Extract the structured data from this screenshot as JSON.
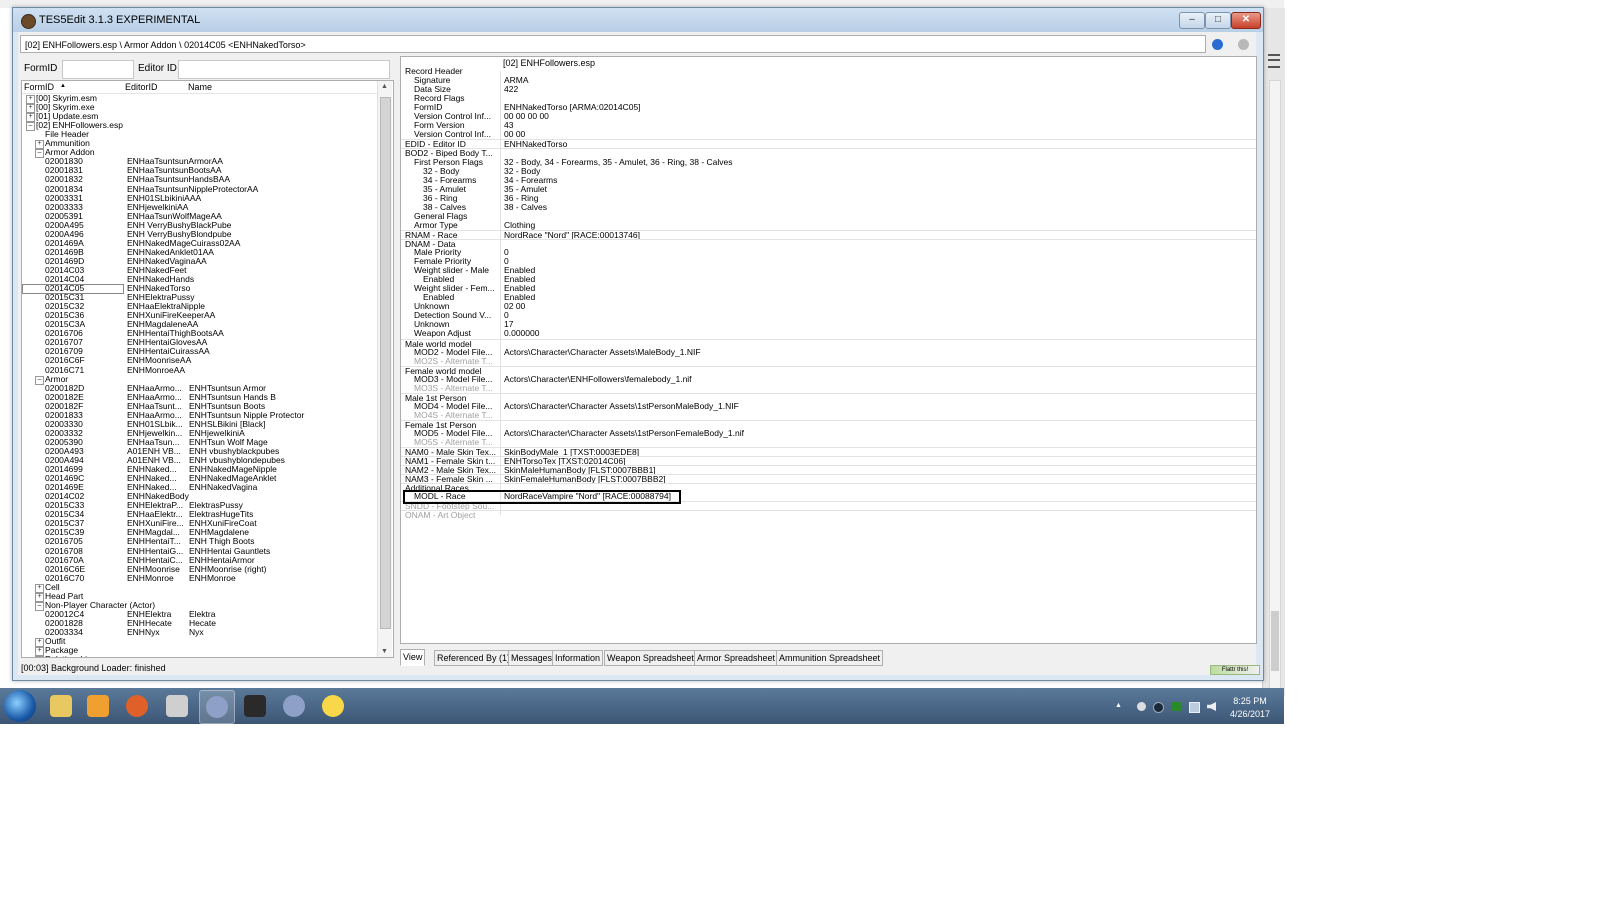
{
  "window": {
    "title": "TES5Edit 3.1.3 EXPERIMENTAL",
    "path": "[02] ENHFollowers.esp \\ Armor Addon \\ 02014C05 <ENHNakedTorso>",
    "controls": {
      "minimize": "–",
      "maximize": "□",
      "close": "✕"
    }
  },
  "filters": {
    "formid_label": "FormID",
    "editorid_label": "Editor ID"
  },
  "tree": {
    "headers": {
      "formid": "FormID",
      "sort_arrow": "▲",
      "editorid": "EditorID",
      "name": "Name"
    },
    "rows": [
      {
        "indent": 0,
        "toggle": "+",
        "id": "[00] Skyrim.esm",
        "edid": "",
        "name": ""
      },
      {
        "indent": 0,
        "toggle": "+",
        "id": "[00] Skyrim.exe",
        "edid": "",
        "name": ""
      },
      {
        "indent": 0,
        "toggle": "+",
        "id": "[01] Update.esm",
        "edid": "",
        "name": ""
      },
      {
        "indent": 0,
        "toggle": "–",
        "id": "[02] ENHFollowers.esp",
        "edid": "",
        "name": ""
      },
      {
        "indent": 1,
        "toggle": "",
        "id": "File Header",
        "edid": "",
        "name": ""
      },
      {
        "indent": 1,
        "toggle": "+",
        "id": "Ammunition",
        "edid": "",
        "name": ""
      },
      {
        "indent": 1,
        "toggle": "–",
        "id": "Armor Addon",
        "edid": "",
        "name": ""
      },
      {
        "indent": 2,
        "toggle": "",
        "id": "02001830",
        "edid": "ENHaaTsuntsunArmorAA",
        "name": ""
      },
      {
        "indent": 2,
        "toggle": "",
        "id": "02001831",
        "edid": "ENHaaTsuntsunBootsAA",
        "name": ""
      },
      {
        "indent": 2,
        "toggle": "",
        "id": "02001832",
        "edid": "ENHaaTsuntsunHandsBAA",
        "name": ""
      },
      {
        "indent": 2,
        "toggle": "",
        "id": "02001834",
        "edid": "ENHaaTsuntsunNippleProtectorAA",
        "name": ""
      },
      {
        "indent": 2,
        "toggle": "",
        "id": "02003331",
        "edid": "ENH01SLbikiniAAA",
        "name": ""
      },
      {
        "indent": 2,
        "toggle": "",
        "id": "02003333",
        "edid": "ENHjewelkiniAA",
        "name": ""
      },
      {
        "indent": 2,
        "toggle": "",
        "id": "02005391",
        "edid": "ENHaaTsunWolfMageAA",
        "name": ""
      },
      {
        "indent": 2,
        "toggle": "",
        "id": "0200A495",
        "edid": "ENH VerryBushyBlackPube",
        "name": ""
      },
      {
        "indent": 2,
        "toggle": "",
        "id": "0200A496",
        "edid": "ENH VerryBushyBlondpube",
        "name": ""
      },
      {
        "indent": 2,
        "toggle": "",
        "id": "0201469A",
        "edid": "ENHNakedMageCuirass02AA",
        "name": ""
      },
      {
        "indent": 2,
        "toggle": "",
        "id": "0201469B",
        "edid": "ENHNakedAnklet01AA",
        "name": ""
      },
      {
        "indent": 2,
        "toggle": "",
        "id": "0201469D",
        "edid": "ENHNakedVaginaAA",
        "name": ""
      },
      {
        "indent": 2,
        "toggle": "",
        "id": "02014C03",
        "edid": "ENHNakedFeet",
        "name": ""
      },
      {
        "indent": 2,
        "toggle": "",
        "id": "02014C04",
        "edid": "ENHNakedHands",
        "name": ""
      },
      {
        "indent": 2,
        "toggle": "",
        "id": "02014C05",
        "edid": "ENHNakedTorso",
        "name": "",
        "selected": true
      },
      {
        "indent": 2,
        "toggle": "",
        "id": "02015C31",
        "edid": "ENHElektraPussy",
        "name": ""
      },
      {
        "indent": 2,
        "toggle": "",
        "id": "02015C32",
        "edid": "ENHaaElektraNipple",
        "name": ""
      },
      {
        "indent": 2,
        "toggle": "",
        "id": "02015C36",
        "edid": "ENHXuniFireKeeperAA",
        "name": ""
      },
      {
        "indent": 2,
        "toggle": "",
        "id": "02015C3A",
        "edid": "ENHMagdaleneAA",
        "name": ""
      },
      {
        "indent": 2,
        "toggle": "",
        "id": "02016706",
        "edid": "ENHHentaiThighBootsAA",
        "name": ""
      },
      {
        "indent": 2,
        "toggle": "",
        "id": "02016707",
        "edid": "ENHHentaiGlovesAA",
        "name": ""
      },
      {
        "indent": 2,
        "toggle": "",
        "id": "02016709",
        "edid": "ENHHentaiCuirassAA",
        "name": ""
      },
      {
        "indent": 2,
        "toggle": "",
        "id": "02016C6F",
        "edid": "ENHMoonriseAA",
        "name": ""
      },
      {
        "indent": 2,
        "toggle": "",
        "id": "02016C71",
        "edid": "ENHMonroeAA",
        "name": ""
      },
      {
        "indent": 1,
        "toggle": "–",
        "id": "Armor",
        "edid": "",
        "name": ""
      },
      {
        "indent": 2,
        "toggle": "",
        "id": "0200182D",
        "edid": "ENHaaArmo...",
        "name": "ENHTsuntsun Armor"
      },
      {
        "indent": 2,
        "toggle": "",
        "id": "0200182E",
        "edid": "ENHaaArmo...",
        "name": "ENHTsuntsun Hands B"
      },
      {
        "indent": 2,
        "toggle": "",
        "id": "0200182F",
        "edid": "ENHaaTsunt...",
        "name": "ENHTsuntsun Boots"
      },
      {
        "indent": 2,
        "toggle": "",
        "id": "02001833",
        "edid": "ENHaaArmo...",
        "name": "ENHTsuntsun Nipple Protector"
      },
      {
        "indent": 2,
        "toggle": "",
        "id": "02003330",
        "edid": "ENH01SLbik...",
        "name": "ENHSLBikini [Black]"
      },
      {
        "indent": 2,
        "toggle": "",
        "id": "02003332",
        "edid": "ENHjewelkin...",
        "name": "ENHjewelkiniA"
      },
      {
        "indent": 2,
        "toggle": "",
        "id": "02005390",
        "edid": "ENHaaTsun...",
        "name": "ENHTsun Wolf Mage"
      },
      {
        "indent": 2,
        "toggle": "",
        "id": "0200A493",
        "edid": "A01ENH VB...",
        "name": "ENH vbushyblackpubes"
      },
      {
        "indent": 2,
        "toggle": "",
        "id": "0200A494",
        "edid": "A01ENH VB...",
        "name": "ENH vbushyblondepubes"
      },
      {
        "indent": 2,
        "toggle": "",
        "id": "02014699",
        "edid": "ENHNaked...",
        "name": "ENHNakedMageNipple"
      },
      {
        "indent": 2,
        "toggle": "",
        "id": "0201469C",
        "edid": "ENHNaked...",
        "name": "ENHNakedMageAnklet"
      },
      {
        "indent": 2,
        "toggle": "",
        "id": "0201469E",
        "edid": "ENHNaked...",
        "name": "ENHNakedVagina"
      },
      {
        "indent": 2,
        "toggle": "",
        "id": "02014C02",
        "edid": "ENHNakedBody",
        "name": ""
      },
      {
        "indent": 2,
        "toggle": "",
        "id": "02015C33",
        "edid": "ENHElektraP...",
        "name": "ElektrasPussy"
      },
      {
        "indent": 2,
        "toggle": "",
        "id": "02015C34",
        "edid": "ENHaaElektr...",
        "name": "ElektrasHugeTits"
      },
      {
        "indent": 2,
        "toggle": "",
        "id": "02015C37",
        "edid": "ENHXuniFire...",
        "name": "ENHXuniFireCoat"
      },
      {
        "indent": 2,
        "toggle": "",
        "id": "02015C39",
        "edid": "ENHMagdal...",
        "name": "ENHMagdalene"
      },
      {
        "indent": 2,
        "toggle": "",
        "id": "02016705",
        "edid": "ENHHentaiT...",
        "name": "ENH Thigh Boots"
      },
      {
        "indent": 2,
        "toggle": "",
        "id": "02016708",
        "edid": "ENHHentaiG...",
        "name": "ENHHentai Gauntlets"
      },
      {
        "indent": 2,
        "toggle": "",
        "id": "0201670A",
        "edid": "ENHHentaiC...",
        "name": "ENHHentaiArmor"
      },
      {
        "indent": 2,
        "toggle": "",
        "id": "02016C6E",
        "edid": "ENHMoonrise",
        "name": "ENHMoonrise (right)"
      },
      {
        "indent": 2,
        "toggle": "",
        "id": "02016C70",
        "edid": "ENHMonroe",
        "name": "ENHMonroe"
      },
      {
        "indent": 1,
        "toggle": "+",
        "id": "Cell",
        "edid": "",
        "name": ""
      },
      {
        "indent": 1,
        "toggle": "+",
        "id": "Head Part",
        "edid": "",
        "name": ""
      },
      {
        "indent": 1,
        "toggle": "–",
        "id": "Non-Player Character (Actor)",
        "edid": "",
        "name": ""
      },
      {
        "indent": 2,
        "toggle": "",
        "id": "020012C4",
        "edid": "ENHElektra",
        "name": "Elektra"
      },
      {
        "indent": 2,
        "toggle": "",
        "id": "02001828",
        "edid": "ENHHecate",
        "name": "Hecate"
      },
      {
        "indent": 2,
        "toggle": "",
        "id": "02003334",
        "edid": "ENHNyx",
        "name": "Nyx"
      },
      {
        "indent": 1,
        "toggle": "+",
        "id": "Outfit",
        "edid": "",
        "name": ""
      },
      {
        "indent": 1,
        "toggle": "+",
        "id": "Package",
        "edid": "",
        "name": ""
      },
      {
        "indent": 1,
        "toggle": "+",
        "id": "Relationship",
        "edid": "",
        "name": ""
      }
    ]
  },
  "record": {
    "header": "[02] ENHFollowers.esp",
    "rows": [
      {
        "indent": 0,
        "label": "Record Header",
        "value": ""
      },
      {
        "indent": 1,
        "label": "Signature",
        "value": "ARMA"
      },
      {
        "indent": 1,
        "label": "Data Size",
        "value": "422"
      },
      {
        "indent": 1,
        "label": "Record Flags",
        "value": ""
      },
      {
        "indent": 1,
        "label": "FormID",
        "value": "ENHNakedTorso [ARMA:02014C05]"
      },
      {
        "indent": 1,
        "label": "Version Control Inf...",
        "value": "00 00 00 00"
      },
      {
        "indent": 1,
        "label": "Form Version",
        "value": "43"
      },
      {
        "indent": 1,
        "label": "Version Control Inf...",
        "value": "00 00"
      },
      {
        "indent": 0,
        "label": "EDID - Editor ID",
        "value": "ENHNakedTorso",
        "sep": true
      },
      {
        "indent": 0,
        "label": "BOD2 - Biped Body T...",
        "value": "",
        "sep": true
      },
      {
        "indent": 1,
        "label": "First Person Flags",
        "value": "32 - Body, 34 - Forearms, 35 - Amulet, 36 - Ring, 38 - Calves"
      },
      {
        "indent": 2,
        "label": "32 - Body",
        "value": "32 - Body"
      },
      {
        "indent": 2,
        "label": "34 - Forearms",
        "value": "34 - Forearms"
      },
      {
        "indent": 2,
        "label": "35 - Amulet",
        "value": "35 - Amulet"
      },
      {
        "indent": 2,
        "label": "36 - Ring",
        "value": "36 - Ring"
      },
      {
        "indent": 2,
        "label": "38 - Calves",
        "value": "38 - Calves"
      },
      {
        "indent": 1,
        "label": "General Flags",
        "value": ""
      },
      {
        "indent": 1,
        "label": "Armor Type",
        "value": "Clothing"
      },
      {
        "indent": 0,
        "label": "RNAM - Race",
        "value": "NordRace \"Nord\" [RACE:00013746]",
        "sep": true
      },
      {
        "indent": 0,
        "label": "DNAM - Data",
        "value": "",
        "sep": true
      },
      {
        "indent": 1,
        "label": "Male Priority",
        "value": "0"
      },
      {
        "indent": 1,
        "label": "Female Priority",
        "value": "0"
      },
      {
        "indent": 1,
        "label": "Weight slider - Male",
        "value": "Enabled"
      },
      {
        "indent": 2,
        "label": "Enabled",
        "value": "Enabled"
      },
      {
        "indent": 1,
        "label": "Weight slider - Fem...",
        "value": "Enabled"
      },
      {
        "indent": 2,
        "label": "Enabled",
        "value": "Enabled"
      },
      {
        "indent": 1,
        "label": "Unknown",
        "value": "02 00"
      },
      {
        "indent": 1,
        "label": "Detection Sound V...",
        "value": "0"
      },
      {
        "indent": 1,
        "label": "Unknown",
        "value": "17"
      },
      {
        "indent": 1,
        "label": "Weapon Adjust",
        "value": "0.000000"
      },
      {
        "indent": 0,
        "label": "Male world model",
        "value": "",
        "sep": true
      },
      {
        "indent": 1,
        "label": "MOD2 - Model File...",
        "value": "Actors\\Character\\Character Assets\\MaleBody_1.NIF"
      },
      {
        "indent": 1,
        "label": "MO2S - Alternate T...",
        "value": "",
        "grey": true
      },
      {
        "indent": 0,
        "label": "Female world model",
        "value": "",
        "sep": true
      },
      {
        "indent": 1,
        "label": "MOD3 - Model File...",
        "value": "Actors\\Character\\ENHFollowers\\femalebody_1.nif"
      },
      {
        "indent": 1,
        "label": "MO3S - Alternate T...",
        "value": "",
        "grey": true
      },
      {
        "indent": 0,
        "label": "Male 1st Person",
        "value": "",
        "sep": true
      },
      {
        "indent": 1,
        "label": "MOD4 - Model File...",
        "value": "Actors\\Character\\Character Assets\\1stPersonMaleBody_1.NIF"
      },
      {
        "indent": 1,
        "label": "MO4S - Alternate T...",
        "value": "",
        "grey": true
      },
      {
        "indent": 0,
        "label": "Female 1st Person",
        "value": "",
        "sep": true
      },
      {
        "indent": 1,
        "label": "MOD5 - Model File...",
        "value": "Actors\\Character\\Character Assets\\1stPersonFemaleBody_1.nif"
      },
      {
        "indent": 1,
        "label": "MO5S - Alternate T...",
        "value": "",
        "grey": true
      },
      {
        "indent": 0,
        "label": "NAM0 - Male Skin Tex...",
        "value": "SkinBodyMale_1 [TXST:0003EDE8]",
        "sep": true
      },
      {
        "indent": 0,
        "label": "NAM1 - Female Skin t...",
        "value": "ENHTorsoTex [TXST:02014C06]",
        "sep": true
      },
      {
        "indent": 0,
        "label": "NAM2 - Male Skin Tex...",
        "value": "SkinMaleHumanBody [FLST:0007BBB1]",
        "sep": true
      },
      {
        "indent": 0,
        "label": "NAM3 - Female Skin ...",
        "value": "SkinFemaleHumanBody [FLST:0007BBB2]",
        "sep": true
      },
      {
        "indent": 0,
        "label": "Additional Races",
        "value": "",
        "sep": true
      },
      {
        "indent": 1,
        "label": "MODL - Race",
        "value": "NordRaceVampire \"Nord\" [RACE:00088794]"
      },
      {
        "indent": 0,
        "label": "SNDD - Footstep Sou...",
        "value": "",
        "grey": true,
        "sep": true
      },
      {
        "indent": 0,
        "label": "ONAM - Art Object",
        "value": "",
        "grey": true,
        "sep": true
      }
    ]
  },
  "tabs": [
    "View",
    "Referenced By (1)",
    "Messages",
    "Information",
    "Weapon Spreadsheet",
    "Armor Spreadsheet",
    "Ammunition Spreadsheet"
  ],
  "status": "[00:03] Background Loader: finished",
  "badge": "Flattr this!",
  "taskbar": {
    "apps": [
      {
        "name": "file-explorer-icon",
        "color": "#e8c860"
      },
      {
        "name": "media-player-icon",
        "color": "#f0a030"
      },
      {
        "name": "firefox-icon",
        "color": "#e0602a"
      },
      {
        "name": "skyrim-icon",
        "color": "#cfcfcf"
      },
      {
        "name": "tes5edit-icon",
        "color": "#8fa0c8",
        "active": true
      },
      {
        "name": "nexus-icon",
        "color": "#2a2a2a"
      },
      {
        "name": "mod-organizer-icon",
        "color": "#8fa0c8"
      },
      {
        "name": "smiley-icon",
        "color": "#f8d848"
      }
    ],
    "time": "8:25 PM",
    "date": "4/26/2017"
  }
}
